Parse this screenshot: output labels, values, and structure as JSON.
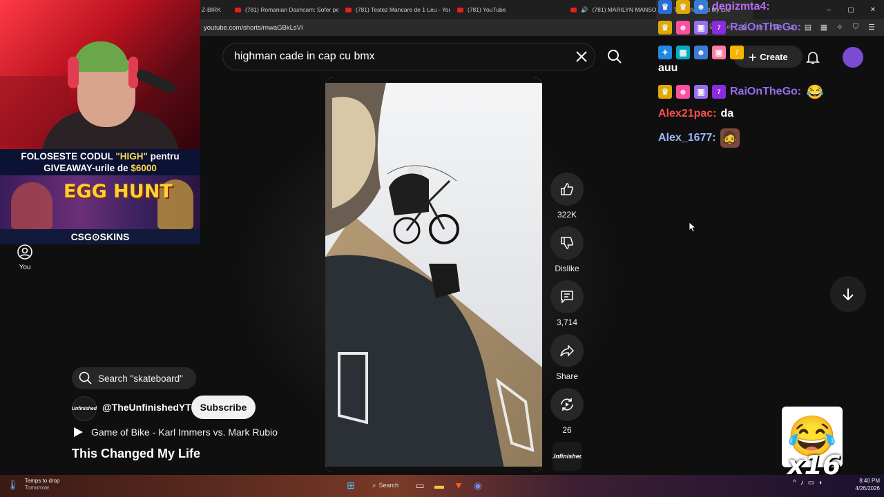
{
  "browser": {
    "tabs": [
      {
        "label": "Z-BIRK"
      },
      {
        "label": "(781) Romanian Dashcam: Sofer pe c"
      },
      {
        "label": "(781) Testez Mancare de 1 Leu - You"
      },
      {
        "label": "(781) YouTube"
      },
      {
        "label": "(781) MARILYN MANSON - Th"
      },
      {
        "label": "This Changed My Life"
      }
    ],
    "url": "youtube.com/shorts/rnwaGBkLsVI",
    "window_controls": [
      "–",
      "▢",
      "✕"
    ]
  },
  "header": {
    "search_value": "highman cade in cap cu bmx",
    "create_label": "Create"
  },
  "overlay": {
    "promo_line1_a": "FOLOSESTE CODUL ",
    "promo_code": "\"HIGH\"",
    "promo_line1_b": " pentru",
    "promo_line2_a": "GIVEAWAY-urile de ",
    "promo_amount": "$6000",
    "egg_title": "EGG HUNT",
    "sponsor": "CSG⊙SKINS"
  },
  "sidebar": {
    "you_label": "You"
  },
  "actions": {
    "like_count": "322K",
    "dislike_label": "Dislike",
    "comment_count": "3,714",
    "share_label": "Share",
    "remix_count": "26",
    "channel_mini": "Unfinished"
  },
  "info": {
    "search_pill": "Search \"skateboard\"",
    "channel_handle": "@TheUnfinishedYT",
    "subscribe_label": "Subscribe",
    "music": "Game of Bike - Karl Immers vs. Mark Rubio",
    "title": "This Changed My Life",
    "channel_avatar_text": "Unfinished"
  },
  "chat": {
    "messages": [
      {
        "user": "denizmta4:",
        "text": "auu",
        "user_color": "#b66cff"
      },
      {
        "user": "RaiOnTheGo:",
        "text": "😂",
        "user_color": "#9b6cf0"
      },
      {
        "user": "Alex21pac:",
        "text": "da",
        "user_color": "#ff4c4c"
      },
      {
        "user": "Alex_1677:",
        "text": "🧔",
        "user_color": "#9fb6ff"
      }
    ],
    "emote_count": "x16",
    "big_emote": "😂"
  },
  "taskbar": {
    "weather_line1": "Temps to drop",
    "weather_line2": "Tomorrow",
    "search_label": "Search",
    "time": "8:40 PM",
    "date": "4/26/2026"
  },
  "colors": {
    "yt_bg": "#0f0f0f",
    "button_bg": "#272727",
    "accent_red": "#e62117"
  }
}
